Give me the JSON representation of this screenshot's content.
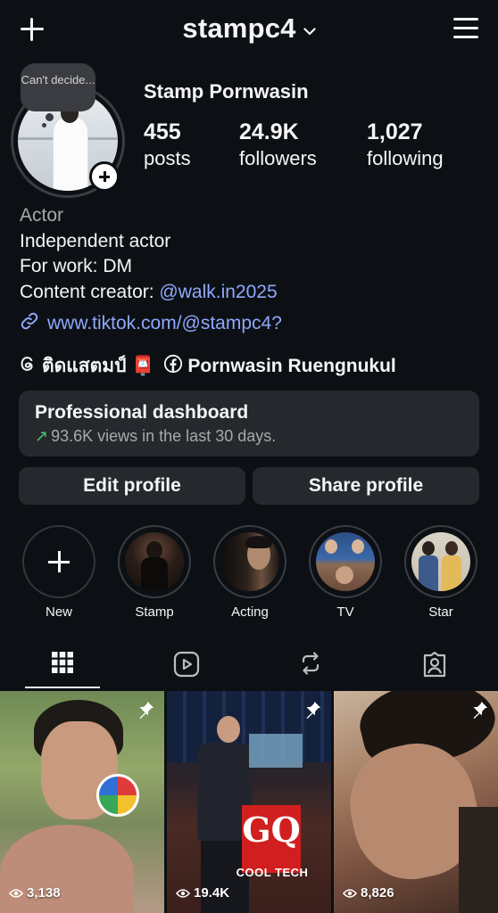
{
  "header": {
    "username": "stampc4",
    "icons": {
      "create": "plus-icon",
      "switch": "chevron-down-icon",
      "menu": "hamburger-menu-icon"
    }
  },
  "profile": {
    "note": "Can't decide...",
    "display_name": "Stamp Pornwasin",
    "stats": [
      {
        "value": "455",
        "label": "posts"
      },
      {
        "value": "24.9K",
        "label": "followers"
      },
      {
        "value": "1,027",
        "label": "following"
      }
    ],
    "bio": {
      "category": "Actor",
      "lines": [
        "Independent actor",
        "For work: DM"
      ],
      "creator_prefix": "Content creator: ",
      "creator_mention": "@walk.in2025"
    },
    "link": "www.tiktok.com/@stampc4?",
    "threads_label": "ติดแสตมป์ 📮",
    "facebook_label": "Pornwasin Ruengnukul"
  },
  "dashboard": {
    "title": "Professional dashboard",
    "subtitle": "93.6K views in the last 30 days."
  },
  "buttons": {
    "edit": "Edit profile",
    "share": "Share profile"
  },
  "highlights": [
    {
      "label": "New"
    },
    {
      "label": "Stamp"
    },
    {
      "label": "Acting"
    },
    {
      "label": "TV"
    },
    {
      "label": "Star"
    }
  ],
  "tabs": [
    {
      "name": "grid",
      "icon": "grid-icon",
      "active": true
    },
    {
      "name": "reels",
      "icon": "reels-icon"
    },
    {
      "name": "reposts",
      "icon": "repost-icon"
    },
    {
      "name": "tagged",
      "icon": "tagged-icon"
    }
  ],
  "posts": [
    {
      "views": "3,138",
      "pinned": true
    },
    {
      "views": "19.4K",
      "pinned": true,
      "overlay_text": "GQ",
      "overlay_sub": "COOL TECH"
    },
    {
      "views": "8,826",
      "pinned": true
    }
  ],
  "colors": {
    "background": "#0c1014",
    "link": "#8fa8ff",
    "card": "#25292e",
    "trend": "#4bc66d"
  }
}
